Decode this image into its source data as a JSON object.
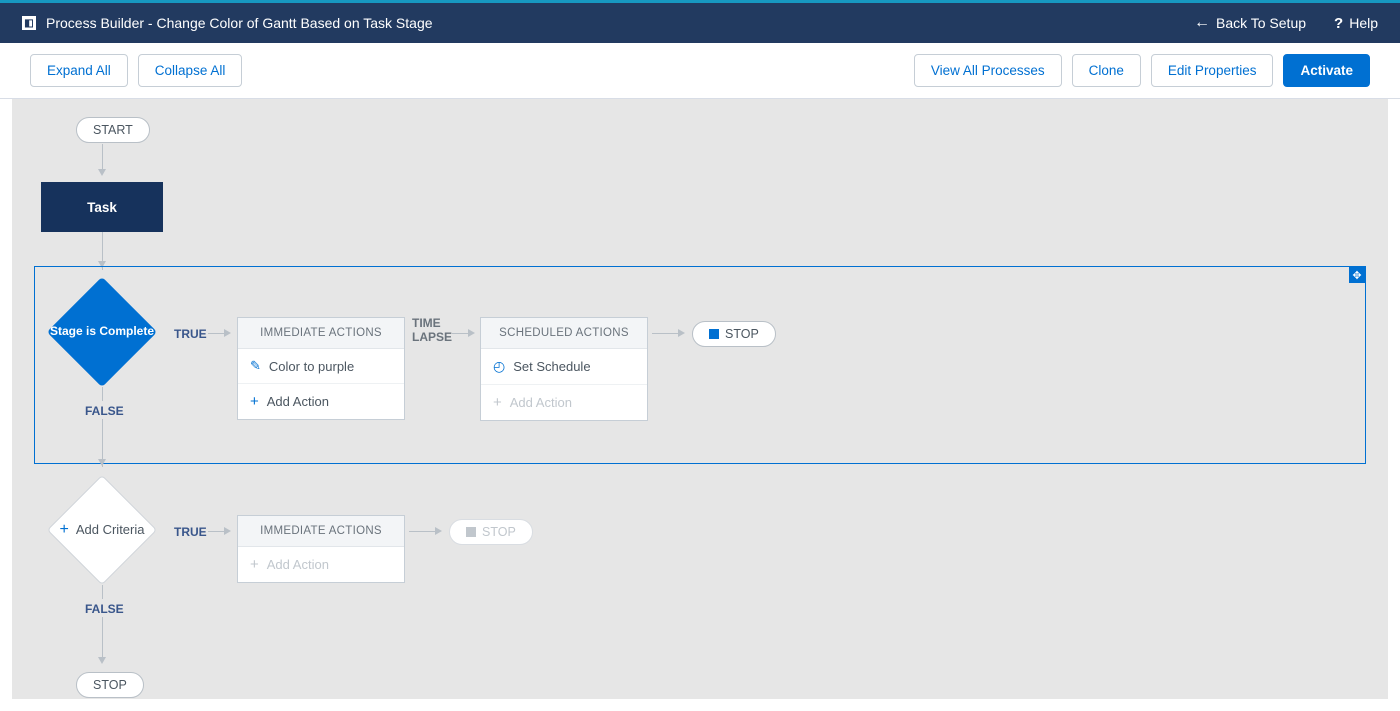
{
  "header": {
    "title": "Process Builder - Change Color of Gantt Based on Task Stage",
    "back_label": "Back To Setup",
    "help_label": "Help"
  },
  "toolbar": {
    "expand_all": "Expand All",
    "collapse_all": "Collapse All",
    "view_all": "View All Processes",
    "clone": "Clone",
    "edit_properties": "Edit Properties",
    "activate": "Activate"
  },
  "flow": {
    "start": "START",
    "object": "Task",
    "row1": {
      "criteria_label": "Stage is Complete",
      "true_label": "TRUE",
      "false_label": "FALSE",
      "immediate_hdr": "IMMEDIATE ACTIONS",
      "immediate_action1": "Color to purple",
      "immediate_add": "Add Action",
      "timelapse_label": "TIME LAPSE",
      "scheduled_hdr": "SCHEDULED ACTIONS",
      "scheduled_set": "Set Schedule",
      "scheduled_add": "Add Action",
      "stop": "STOP"
    },
    "row2": {
      "criteria_label": "Add Criteria",
      "true_label": "TRUE",
      "false_label": "FALSE",
      "immediate_hdr": "IMMEDIATE ACTIONS",
      "immediate_add": "Add Action",
      "stop": "STOP"
    },
    "end_stop": "STOP"
  }
}
